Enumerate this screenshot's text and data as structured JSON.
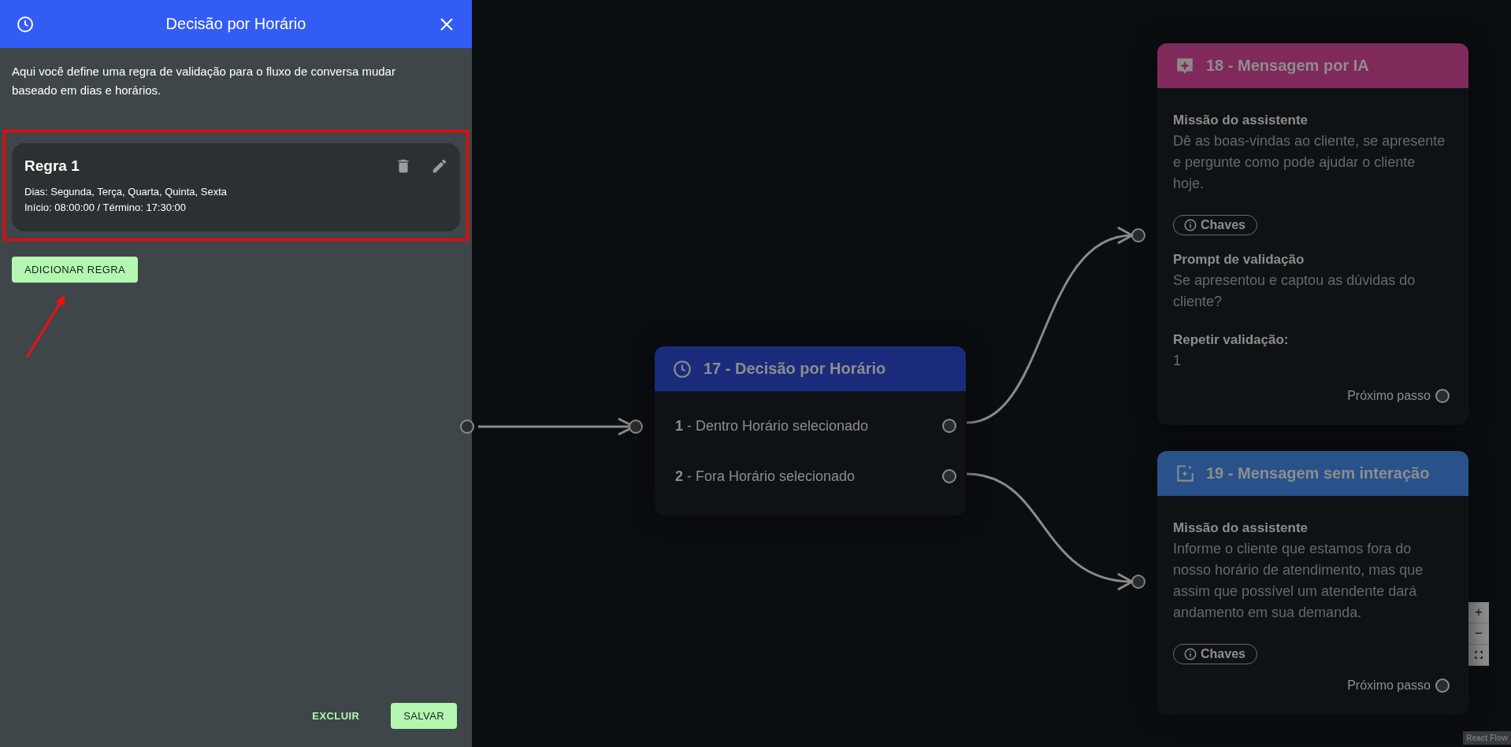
{
  "panel": {
    "title": "Decisão por Horário",
    "description": "Aqui você define uma regra de validação para o fluxo de conversa mudar baseado em dias e horários.",
    "rules": [
      {
        "title": "Regra 1",
        "days": "Dias: Segunda, Terça, Quarta, Quinta, Sexta",
        "hours": "Início: 08:00:00 / Término: 17:30:00"
      }
    ],
    "add_button": "ADICIONAR REGRA",
    "delete_button": "EXCLUIR",
    "save_button": "SALVAR"
  },
  "canvas": {
    "nodes": [
      {
        "kind": "decision",
        "title": "17 - Decisão por Horário",
        "color": "#1a2b7c",
        "options": [
          "**1** - Dentro Horário selecionado",
          "**2** - Fora Horário selecionado"
        ]
      },
      {
        "kind": "ai_message",
        "title": "18 - Mensagem por IA",
        "color": "#7f2a5b",
        "blocks": [
          {
            "kind": "field",
            "label": "Missão do assistente",
            "text": "Dê as boas-vindas ao cliente, se apresente e pergunte como pode ajudar o cliente hoje."
          },
          {
            "kind": "chip",
            "label": "Chaves"
          },
          {
            "kind": "field",
            "label": "Prompt de validação",
            "text": "Se apresentou e captou as dúvidas do cliente?"
          },
          {
            "kind": "field",
            "label": "Repetir validação:",
            "text": "1"
          },
          {
            "kind": "next",
            "label": "Próximo passo"
          }
        ]
      },
      {
        "kind": "message",
        "title": "19 - Mensagem sem interação",
        "color": "#29528a",
        "blocks": [
          {
            "kind": "field",
            "label": "Missão do assistente",
            "text": "Informe o cliente que estamos fora do nosso horário de atendimento, mas que assim que possível um atendente dará andamento em sua demanda."
          },
          {
            "kind": "chip",
            "label": "Chaves"
          },
          {
            "kind": "next",
            "label": "Próximo passo"
          }
        ]
      }
    ],
    "controls": [
      "+",
      "−"
    ],
    "attribution": "React Flow"
  }
}
